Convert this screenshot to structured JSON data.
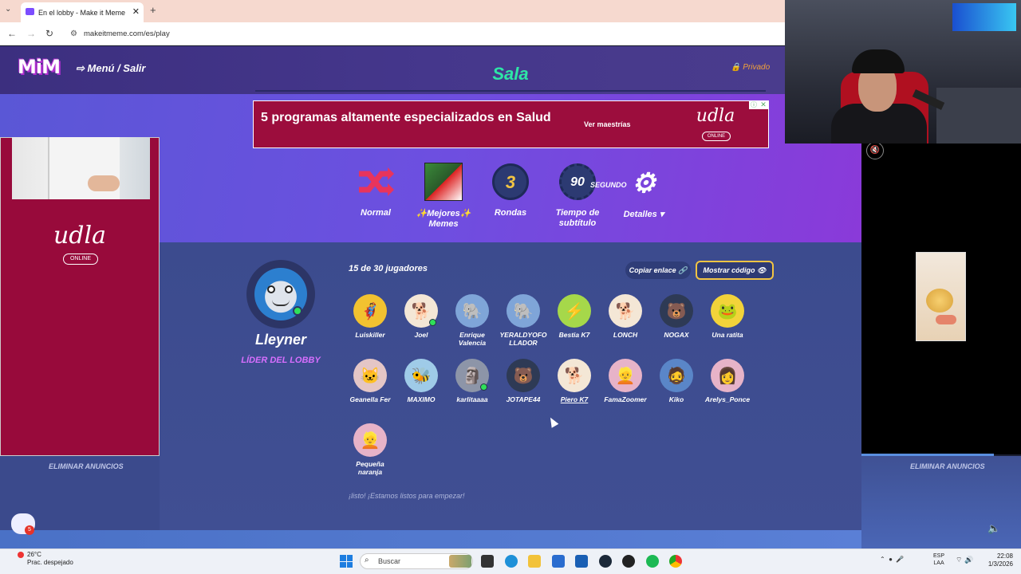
{
  "browser": {
    "tab_title": "En el lobby - Make it Meme",
    "url": "makeitmeme.com/es/play"
  },
  "header": {
    "logo": "MiM",
    "menu_label": "Menú / Salir",
    "title": "Sala",
    "privacy": "Privado"
  },
  "ad_banner": {
    "text": "5 programas altamente especializados en Salud",
    "cta": "Ver maestrías",
    "brand": "udla",
    "brand_sub": "ONLINE"
  },
  "settings": [
    {
      "label": "Normal",
      "icon": "shuffle-icon"
    },
    {
      "label": "✨Mejores✨ Memes",
      "icon": "meme-thumbnail"
    },
    {
      "label": "Rondas",
      "value": "3",
      "icon": "rounds-icon"
    },
    {
      "label": "Tiempo de subtítulo",
      "value": "90",
      "unit": "SEGUNDO",
      "icon": "timer-icon"
    },
    {
      "label": "Detalles",
      "icon": "gear-icon"
    }
  ],
  "side_ads": {
    "left_brand": "udla",
    "left_brand_sub": "ONLINE",
    "remove_left": "ELIMINAR ANUNCIOS",
    "remove_right": "ELIMINAR ANUNCIOS"
  },
  "leader": {
    "name": "Lleyner",
    "role": "LÍDER DEL LOBBY"
  },
  "lobby": {
    "player_count": "15 de 30 jugadores",
    "copy_link": "Copiar enlace",
    "show_code": "Mostrar código",
    "ready_text": "¡listo! ¡Estamos listos para empezar!"
  },
  "players": [
    {
      "name": "Luiskiller",
      "color": "#f2c230",
      "emoji": "🦸"
    },
    {
      "name": "Joel",
      "color": "#f4e7d6",
      "emoji": "🐕",
      "online": true
    },
    {
      "name": "Enrique Valencia",
      "color": "#7fa5d8",
      "emoji": "🐘"
    },
    {
      "name": "YERALDYOFOLLADOR",
      "color": "#7fa5d8",
      "emoji": "🐘"
    },
    {
      "name": "Bestia K7",
      "color": "#a6d84a",
      "emoji": "⚡"
    },
    {
      "name": "LONCH",
      "color": "#f4e7d6",
      "emoji": "🐕"
    },
    {
      "name": "NOGAX",
      "color": "#2e3a55",
      "emoji": "🐻"
    },
    {
      "name": "Una ratita",
      "color": "#f2d33a",
      "emoji": "🐸"
    },
    {
      "name": "Geanella Fer",
      "color": "#e4c6c6",
      "emoji": "🐱"
    },
    {
      "name": "MAXIMO",
      "color": "#9fcbe8",
      "emoji": "🐝"
    },
    {
      "name": "karlitaaaa",
      "color": "#8d95a8",
      "emoji": "🗿",
      "online": true
    },
    {
      "name": "JOTAPE44",
      "color": "#2e3a55",
      "emoji": "🐻"
    },
    {
      "name": "Piero K7",
      "color": "#f4e7d6",
      "emoji": "🐕",
      "underline": true
    },
    {
      "name": "FamaZoomer",
      "color": "#e7b3c8",
      "emoji": "👱"
    },
    {
      "name": "Kiko",
      "color": "#5a86c8",
      "emoji": "🧔"
    },
    {
      "name": "Arelys_Ponce",
      "color": "#e7b3c8",
      "emoji": "👩"
    },
    {
      "name": "Pequeña naranja",
      "color": "#e7b3c8",
      "emoji": "👱"
    }
  ],
  "chat": {
    "badge": "5"
  },
  "taskbar": {
    "temp": "26°C",
    "weather": "Prac. despejado",
    "weather_badge": "2",
    "search_placeholder": "Buscar",
    "lang1": "ESP",
    "lang2": "LAA",
    "time": "22:08",
    "date": "1/3/2026"
  }
}
